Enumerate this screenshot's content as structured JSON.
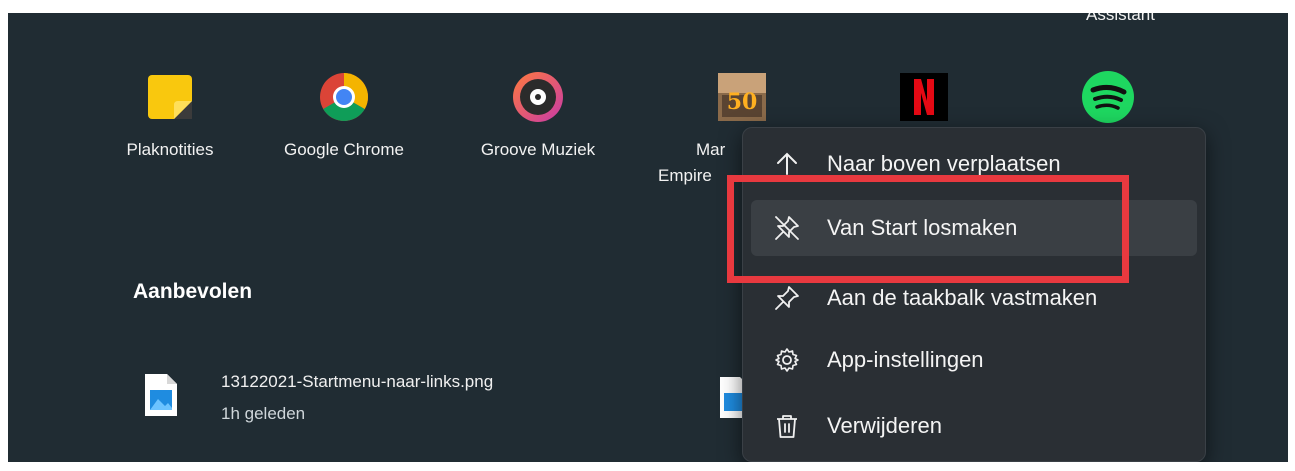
{
  "top_cutoff_label": "Assistant",
  "pinned_apps": [
    {
      "label": "Plaknotities",
      "icon": "sticky-notes-icon"
    },
    {
      "label": "Google Chrome",
      "icon": "chrome-icon"
    },
    {
      "label": "Groove Muziek",
      "icon": "groove-music-icon"
    },
    {
      "label_line1": "Mar",
      "label_line2": "Empire",
      "icon": "game-50-icon"
    },
    {
      "label": "",
      "icon": "netflix-icon"
    },
    {
      "label": "",
      "icon": "spotify-icon"
    }
  ],
  "recommended": {
    "title": "Aanbevolen",
    "items": [
      {
        "name": "13122021-Startmenu-naar-links.png",
        "time": "1h geleden",
        "icon": "image-file-icon"
      }
    ]
  },
  "context_menu": {
    "items": [
      {
        "label": "Naar boven verplaatsen",
        "icon": "arrow-up-icon"
      },
      {
        "label": "Van Start losmaken",
        "icon": "unpin-icon",
        "hover": true
      },
      {
        "label": "Aan de taakbalk vastmaken",
        "icon": "pin-icon"
      },
      {
        "label": "App-instellingen",
        "icon": "gear-icon"
      },
      {
        "label": "Verwijderen",
        "icon": "trash-icon"
      }
    ]
  },
  "colors": {
    "background": "#202c33",
    "menu": "#2a2f34",
    "highlight": "#e8393f"
  }
}
